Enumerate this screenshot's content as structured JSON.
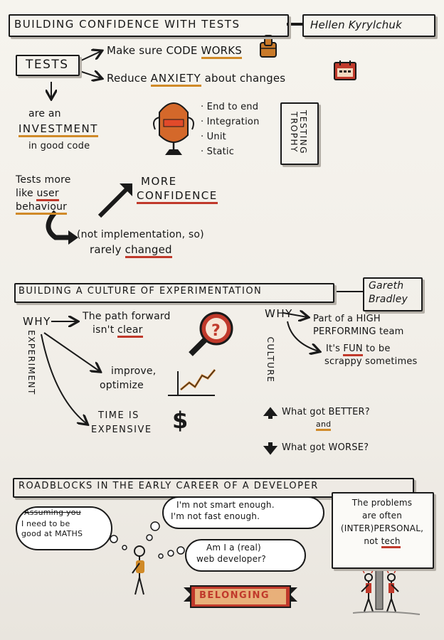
{
  "section1": {
    "title": "BUILDING CONFIDENCE WITH TESTS",
    "speaker": "Hellen Kyrylchuk",
    "tests_label": "TESTS",
    "arrow1_pre": "Make sure ",
    "arrow1_code": "CODE",
    "arrow1_works": "WORKS",
    "arrow2_pre": "Reduce ",
    "arrow2_anxiety": "ANXIETY",
    "arrow2_post": " about changes",
    "are_an": "are an",
    "investment": "INVESTMENT",
    "in_good_code": "in good code",
    "trophy_items": [
      "End to end",
      "Integration",
      "Unit",
      "Static"
    ],
    "testing_trophy": "TESTING TROPHY",
    "tests_more_line1": "Tests more",
    "tests_more_like": "like ",
    "tests_more_user": "user",
    "tests_more_behaviour": "behaviour",
    "more": "MORE",
    "confidence": "CONFIDENCE",
    "not_impl": "(not implementation, so)",
    "rarely": "rarely ",
    "changed": "changed"
  },
  "section2": {
    "title": "BUILDING A CULTURE OF EXPERIMENTATION",
    "speaker_line1": "Gareth",
    "speaker_line2": "Bradley",
    "why_left": "WHY",
    "experiment_vertical": "EXPERIMENT",
    "path_line1": "The path forward",
    "path_line2_pre": "isn't ",
    "path_line2_clear": "clear",
    "improve_line1": "improve,",
    "improve_line2": "optimize",
    "time_line1": "TIME IS",
    "time_line2": "EXPENSIVE",
    "why_right": "WHY",
    "culture_vertical": "CULTURE",
    "part_line1": "Part of a HIGH",
    "part_line2": "PERFORMING team",
    "fun_pre": "It's ",
    "fun_word": "FUN",
    "fun_post": " to be",
    "scrappy": "scrappy sometimes",
    "better": "What got BETTER?",
    "and": "and",
    "worse": "What got WORSE?"
  },
  "section3": {
    "title": "ROADBLOCKS IN THE EARLY CAREER OF A DEVELOPER",
    "struck": "Assuming you",
    "cloud1_line1": "I need to be",
    "cloud1_line2": "good at MATHS",
    "cloud2_line1": "I'm not smart enough.",
    "cloud2_line2": "I'm not fast enough.",
    "cloud3_line1": "Am I a (real)",
    "cloud3_line2": "web developer?",
    "belonging": "BELONGING",
    "sign_line1": "The problems",
    "sign_line2": "are often",
    "sign_line3": "(INTER)PERSONAL,",
    "sign_line4_pre": "not ",
    "sign_line4_tech": "tech"
  },
  "colors": {
    "ink": "#1a1a1a",
    "orange": "#d08a28",
    "red": "#c0392b",
    "gray_shadow": "#b5b0a8"
  },
  "icons": [
    "thumbs-up-icon",
    "calendar-icon",
    "trophy-icon",
    "magnifier-question-icon",
    "growth-chart-icon",
    "dollar-icon",
    "arrow-up-icon",
    "arrow-down-icon",
    "person-icon",
    "crowd-icon"
  ]
}
